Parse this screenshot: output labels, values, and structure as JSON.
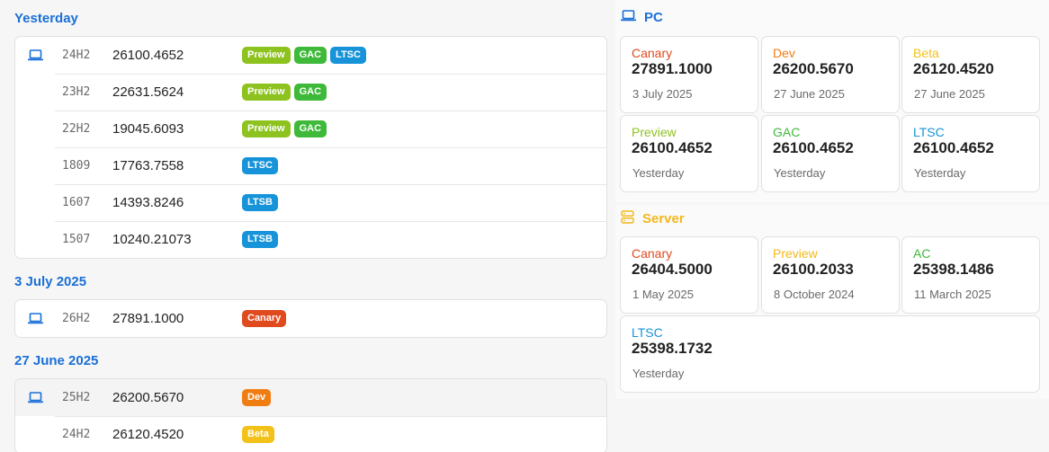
{
  "colors": {
    "accent_blue": "#1a6fd6",
    "preview": "#8dc21f",
    "gac": "#3fb93a",
    "ltsc": "#1693d9",
    "canary": "#e04a1f",
    "dev": "#f07d12",
    "beta": "#f3c21a"
  },
  "groups": [
    {
      "label": "Yesterday",
      "rows": [
        {
          "icon": "laptop-icon",
          "version": "24H2",
          "build": "26100.4652",
          "badges": [
            {
              "label": "Preview",
              "color": "#8dc21f"
            },
            {
              "label": "GAC",
              "color": "#3fb93a"
            },
            {
              "label": "LTSC",
              "color": "#1693d9"
            }
          ]
        },
        {
          "icon": "",
          "version": "23H2",
          "build": "22631.5624",
          "badges": [
            {
              "label": "Preview",
              "color": "#8dc21f"
            },
            {
              "label": "GAC",
              "color": "#3fb93a"
            }
          ]
        },
        {
          "icon": "",
          "version": "22H2",
          "build": "19045.6093",
          "badges": [
            {
              "label": "Preview",
              "color": "#8dc21f"
            },
            {
              "label": "GAC",
              "color": "#3fb93a"
            }
          ]
        },
        {
          "icon": "",
          "version": "1809",
          "build": "17763.7558",
          "badges": [
            {
              "label": "LTSC",
              "color": "#1693d9"
            }
          ]
        },
        {
          "icon": "",
          "version": "1607",
          "build": "14393.8246",
          "badges": [
            {
              "label": "LTSB",
              "color": "#1693d9"
            }
          ]
        },
        {
          "icon": "",
          "version": "1507",
          "build": "10240.21073",
          "badges": [
            {
              "label": "LTSB",
              "color": "#1693d9"
            }
          ]
        }
      ]
    },
    {
      "label": "3 July 2025",
      "rows": [
        {
          "icon": "laptop-icon",
          "version": "26H2",
          "build": "27891.1000",
          "badges": [
            {
              "label": "Canary",
              "color": "#e04a1f"
            }
          ]
        }
      ]
    },
    {
      "label": "27 June 2025",
      "rows": [
        {
          "icon": "laptop-icon",
          "version": "25H2",
          "build": "26200.5670",
          "badges": [
            {
              "label": "Dev",
              "color": "#f07d12"
            }
          ]
        },
        {
          "icon": "",
          "version": "24H2",
          "build": "26120.4520",
          "badges": [
            {
              "label": "Beta",
              "color": "#f3c21a"
            }
          ]
        }
      ]
    }
  ],
  "pc": {
    "title": "PC",
    "title_color": "#1a6fd6",
    "icon": "laptop-icon",
    "tiles": [
      {
        "name": "Canary",
        "color": "#e04a1f",
        "build": "27891.1000",
        "date": "3 July 2025"
      },
      {
        "name": "Dev",
        "color": "#f07d12",
        "build": "26200.5670",
        "date": "27 June 2025"
      },
      {
        "name": "Beta",
        "color": "#f3c21a",
        "build": "26120.4520",
        "date": "27 June 2025"
      },
      {
        "name": "Preview",
        "color": "#8dc21f",
        "build": "26100.4652",
        "date": "Yesterday"
      },
      {
        "name": "GAC",
        "color": "#3fb93a",
        "build": "26100.4652",
        "date": "Yesterday"
      },
      {
        "name": "LTSC",
        "color": "#1693d9",
        "build": "26100.4652",
        "date": "Yesterday"
      }
    ]
  },
  "server": {
    "title": "Server",
    "title_color": "#f3b81a",
    "icon": "server-icon",
    "tiles": [
      {
        "name": "Canary",
        "color": "#e04a1f",
        "build": "26404.5000",
        "date": "1 May 2025"
      },
      {
        "name": "Preview",
        "color": "#f3b81a",
        "build": "26100.2033",
        "date": "8 October 2024"
      },
      {
        "name": "AC",
        "color": "#3fb93a",
        "build": "25398.1486",
        "date": "11 March 2025"
      },
      {
        "name": "LTSC",
        "color": "#1693d9",
        "build": "25398.1732",
        "date": "Yesterday"
      }
    ]
  }
}
